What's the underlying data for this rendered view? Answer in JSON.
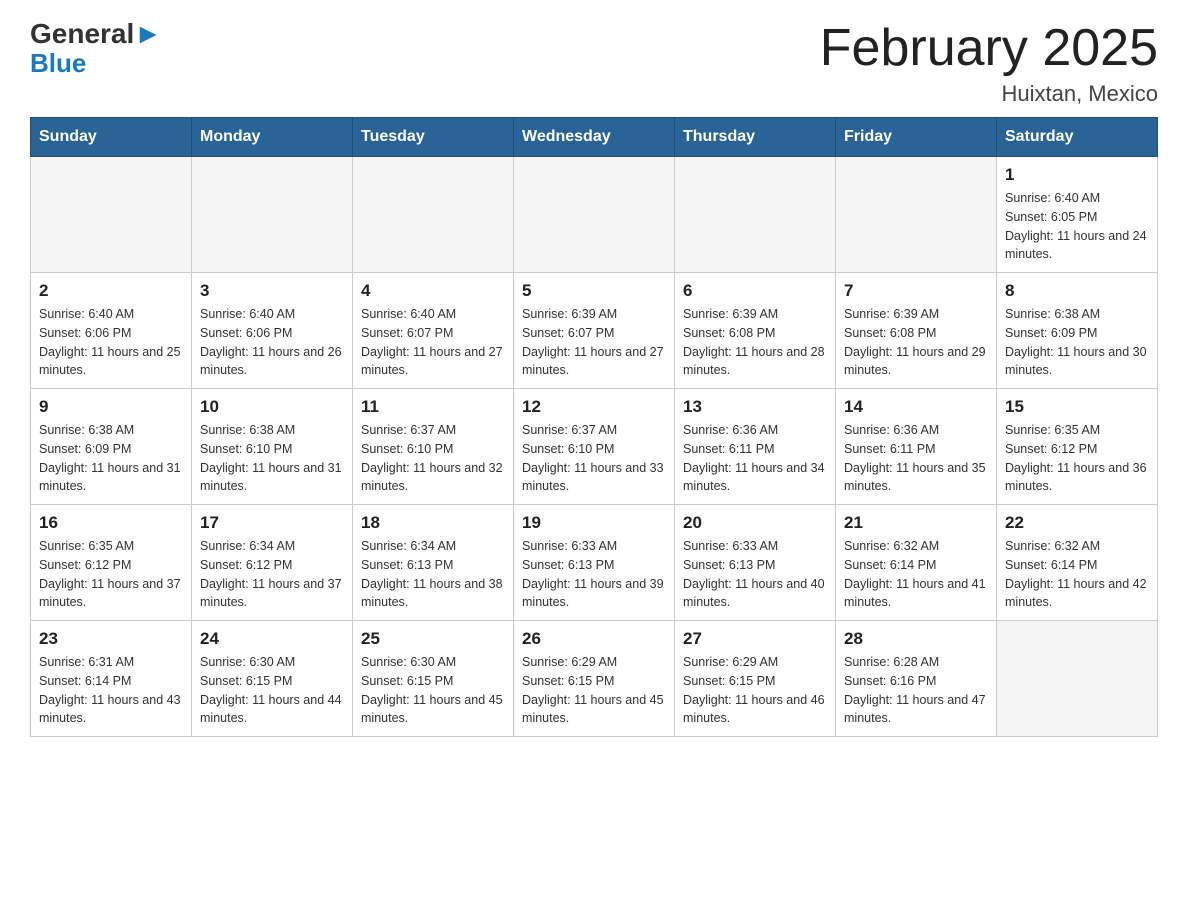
{
  "header": {
    "logo_top": "General",
    "logo_bottom": "Blue",
    "title": "February 2025",
    "subtitle": "Huixtan, Mexico"
  },
  "weekdays": [
    "Sunday",
    "Monday",
    "Tuesday",
    "Wednesday",
    "Thursday",
    "Friday",
    "Saturday"
  ],
  "weeks": [
    [
      {
        "day": "",
        "sunrise": "",
        "sunset": "",
        "daylight": ""
      },
      {
        "day": "",
        "sunrise": "",
        "sunset": "",
        "daylight": ""
      },
      {
        "day": "",
        "sunrise": "",
        "sunset": "",
        "daylight": ""
      },
      {
        "day": "",
        "sunrise": "",
        "sunset": "",
        "daylight": ""
      },
      {
        "day": "",
        "sunrise": "",
        "sunset": "",
        "daylight": ""
      },
      {
        "day": "",
        "sunrise": "",
        "sunset": "",
        "daylight": ""
      },
      {
        "day": "1",
        "sunrise": "Sunrise: 6:40 AM",
        "sunset": "Sunset: 6:05 PM",
        "daylight": "Daylight: 11 hours and 24 minutes."
      }
    ],
    [
      {
        "day": "2",
        "sunrise": "Sunrise: 6:40 AM",
        "sunset": "Sunset: 6:06 PM",
        "daylight": "Daylight: 11 hours and 25 minutes."
      },
      {
        "day": "3",
        "sunrise": "Sunrise: 6:40 AM",
        "sunset": "Sunset: 6:06 PM",
        "daylight": "Daylight: 11 hours and 26 minutes."
      },
      {
        "day": "4",
        "sunrise": "Sunrise: 6:40 AM",
        "sunset": "Sunset: 6:07 PM",
        "daylight": "Daylight: 11 hours and 27 minutes."
      },
      {
        "day": "5",
        "sunrise": "Sunrise: 6:39 AM",
        "sunset": "Sunset: 6:07 PM",
        "daylight": "Daylight: 11 hours and 27 minutes."
      },
      {
        "day": "6",
        "sunrise": "Sunrise: 6:39 AM",
        "sunset": "Sunset: 6:08 PM",
        "daylight": "Daylight: 11 hours and 28 minutes."
      },
      {
        "day": "7",
        "sunrise": "Sunrise: 6:39 AM",
        "sunset": "Sunset: 6:08 PM",
        "daylight": "Daylight: 11 hours and 29 minutes."
      },
      {
        "day": "8",
        "sunrise": "Sunrise: 6:38 AM",
        "sunset": "Sunset: 6:09 PM",
        "daylight": "Daylight: 11 hours and 30 minutes."
      }
    ],
    [
      {
        "day": "9",
        "sunrise": "Sunrise: 6:38 AM",
        "sunset": "Sunset: 6:09 PM",
        "daylight": "Daylight: 11 hours and 31 minutes."
      },
      {
        "day": "10",
        "sunrise": "Sunrise: 6:38 AM",
        "sunset": "Sunset: 6:10 PM",
        "daylight": "Daylight: 11 hours and 31 minutes."
      },
      {
        "day": "11",
        "sunrise": "Sunrise: 6:37 AM",
        "sunset": "Sunset: 6:10 PM",
        "daylight": "Daylight: 11 hours and 32 minutes."
      },
      {
        "day": "12",
        "sunrise": "Sunrise: 6:37 AM",
        "sunset": "Sunset: 6:10 PM",
        "daylight": "Daylight: 11 hours and 33 minutes."
      },
      {
        "day": "13",
        "sunrise": "Sunrise: 6:36 AM",
        "sunset": "Sunset: 6:11 PM",
        "daylight": "Daylight: 11 hours and 34 minutes."
      },
      {
        "day": "14",
        "sunrise": "Sunrise: 6:36 AM",
        "sunset": "Sunset: 6:11 PM",
        "daylight": "Daylight: 11 hours and 35 minutes."
      },
      {
        "day": "15",
        "sunrise": "Sunrise: 6:35 AM",
        "sunset": "Sunset: 6:12 PM",
        "daylight": "Daylight: 11 hours and 36 minutes."
      }
    ],
    [
      {
        "day": "16",
        "sunrise": "Sunrise: 6:35 AM",
        "sunset": "Sunset: 6:12 PM",
        "daylight": "Daylight: 11 hours and 37 minutes."
      },
      {
        "day": "17",
        "sunrise": "Sunrise: 6:34 AM",
        "sunset": "Sunset: 6:12 PM",
        "daylight": "Daylight: 11 hours and 37 minutes."
      },
      {
        "day": "18",
        "sunrise": "Sunrise: 6:34 AM",
        "sunset": "Sunset: 6:13 PM",
        "daylight": "Daylight: 11 hours and 38 minutes."
      },
      {
        "day": "19",
        "sunrise": "Sunrise: 6:33 AM",
        "sunset": "Sunset: 6:13 PM",
        "daylight": "Daylight: 11 hours and 39 minutes."
      },
      {
        "day": "20",
        "sunrise": "Sunrise: 6:33 AM",
        "sunset": "Sunset: 6:13 PM",
        "daylight": "Daylight: 11 hours and 40 minutes."
      },
      {
        "day": "21",
        "sunrise": "Sunrise: 6:32 AM",
        "sunset": "Sunset: 6:14 PM",
        "daylight": "Daylight: 11 hours and 41 minutes."
      },
      {
        "day": "22",
        "sunrise": "Sunrise: 6:32 AM",
        "sunset": "Sunset: 6:14 PM",
        "daylight": "Daylight: 11 hours and 42 minutes."
      }
    ],
    [
      {
        "day": "23",
        "sunrise": "Sunrise: 6:31 AM",
        "sunset": "Sunset: 6:14 PM",
        "daylight": "Daylight: 11 hours and 43 minutes."
      },
      {
        "day": "24",
        "sunrise": "Sunrise: 6:30 AM",
        "sunset": "Sunset: 6:15 PM",
        "daylight": "Daylight: 11 hours and 44 minutes."
      },
      {
        "day": "25",
        "sunrise": "Sunrise: 6:30 AM",
        "sunset": "Sunset: 6:15 PM",
        "daylight": "Daylight: 11 hours and 45 minutes."
      },
      {
        "day": "26",
        "sunrise": "Sunrise: 6:29 AM",
        "sunset": "Sunset: 6:15 PM",
        "daylight": "Daylight: 11 hours and 45 minutes."
      },
      {
        "day": "27",
        "sunrise": "Sunrise: 6:29 AM",
        "sunset": "Sunset: 6:15 PM",
        "daylight": "Daylight: 11 hours and 46 minutes."
      },
      {
        "day": "28",
        "sunrise": "Sunrise: 6:28 AM",
        "sunset": "Sunset: 6:16 PM",
        "daylight": "Daylight: 11 hours and 47 minutes."
      },
      {
        "day": "",
        "sunrise": "",
        "sunset": "",
        "daylight": ""
      }
    ]
  ]
}
